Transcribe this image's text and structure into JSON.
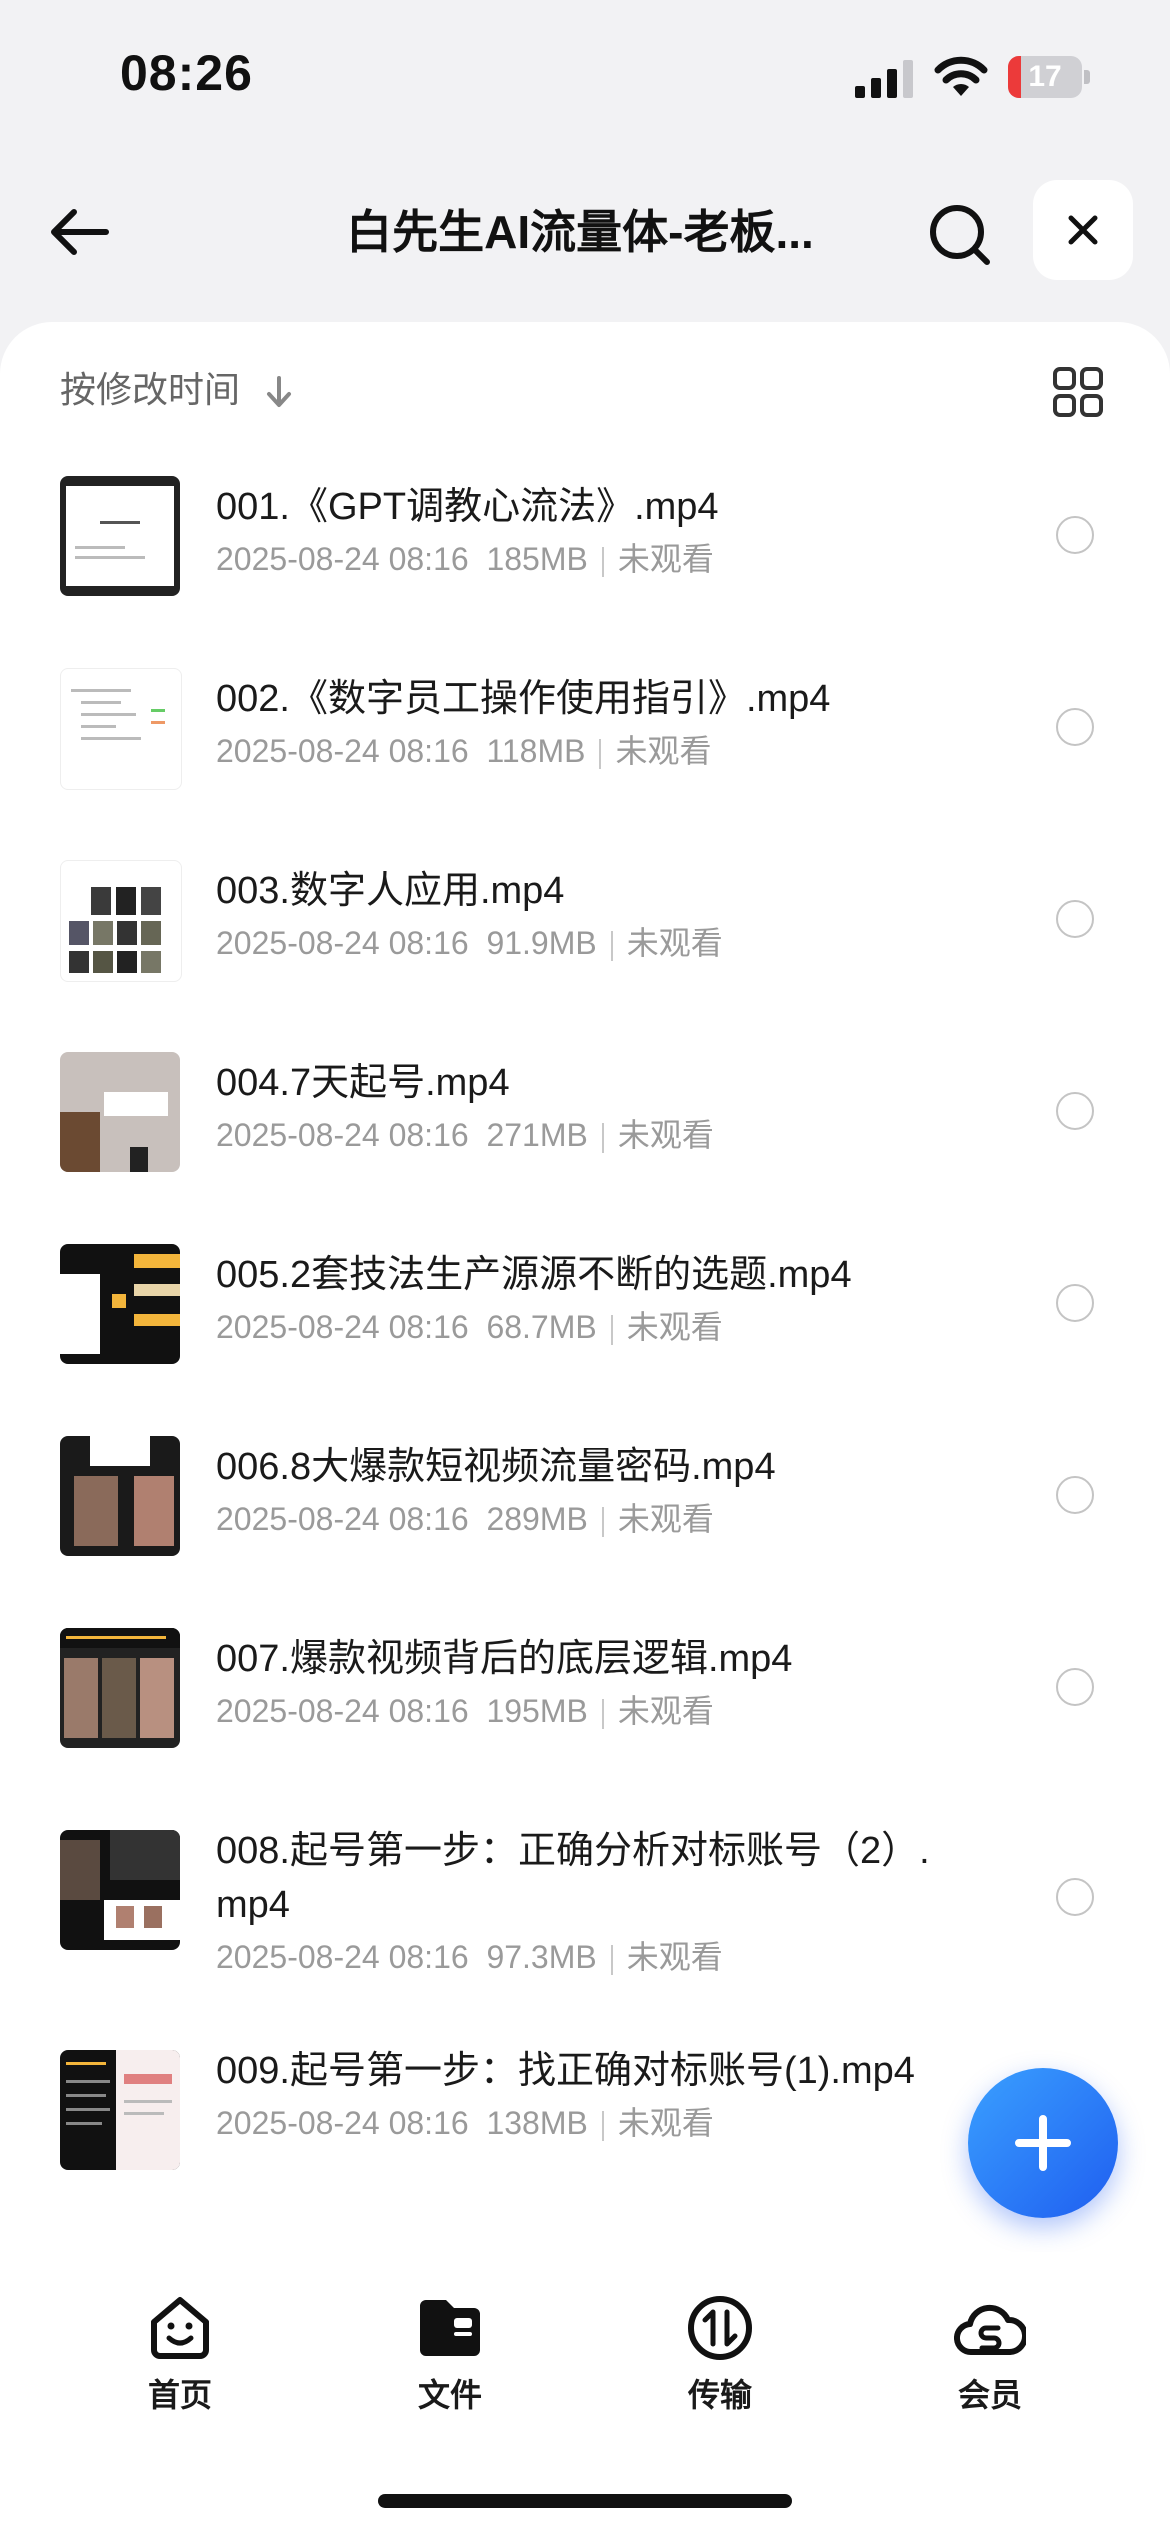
{
  "status_bar": {
    "time": "08:26",
    "battery": "17",
    "battery_level": 0.17
  },
  "header": {
    "title": "白先生AI流量体-老板..."
  },
  "sort": {
    "label": "按修改时间"
  },
  "files": [
    {
      "name": "001.《GPT调教心流法》.mp4",
      "date": "2025-08-24 08:16",
      "size": "185MB",
      "status": "未观看"
    },
    {
      "name": "002.《数字员工操作使用指引》.mp4",
      "date": "2025-08-24 08:16",
      "size": "118MB",
      "status": "未观看"
    },
    {
      "name": "003.数字人应用.mp4",
      "date": "2025-08-24 08:16",
      "size": "91.9MB",
      "status": "未观看"
    },
    {
      "name": "004.7天起号.mp4",
      "date": "2025-08-24 08:16",
      "size": "271MB",
      "status": "未观看"
    },
    {
      "name": "005.2套技法生产源源不断的选题.mp4",
      "date": "2025-08-24 08:16",
      "size": "68.7MB",
      "status": "未观看"
    },
    {
      "name": "006.8大爆款短视频流量密码.mp4",
      "date": "2025-08-24 08:16",
      "size": "289MB",
      "status": "未观看"
    },
    {
      "name": "007.爆款视频背后的底层逻辑.mp4",
      "date": "2025-08-24 08:16",
      "size": "195MB",
      "status": "未观看"
    },
    {
      "name": "008.起号第一步：正确分析对标账号（2）.mp4",
      "date": "2025-08-24 08:16",
      "size": "97.3MB",
      "status": "未观看"
    },
    {
      "name": "009.起号第一步：找正确对标账号(1).mp4",
      "date": "2025-08-24 08:16",
      "size": "138MB",
      "status": "未观看"
    }
  ],
  "tabbar": {
    "home": "首页",
    "files": "文件",
    "transfer": "传输",
    "member": "会员"
  },
  "colors": {
    "accent": "#1f6bf5",
    "text": "#1a1a1a",
    "muted": "#9a9a9a"
  }
}
